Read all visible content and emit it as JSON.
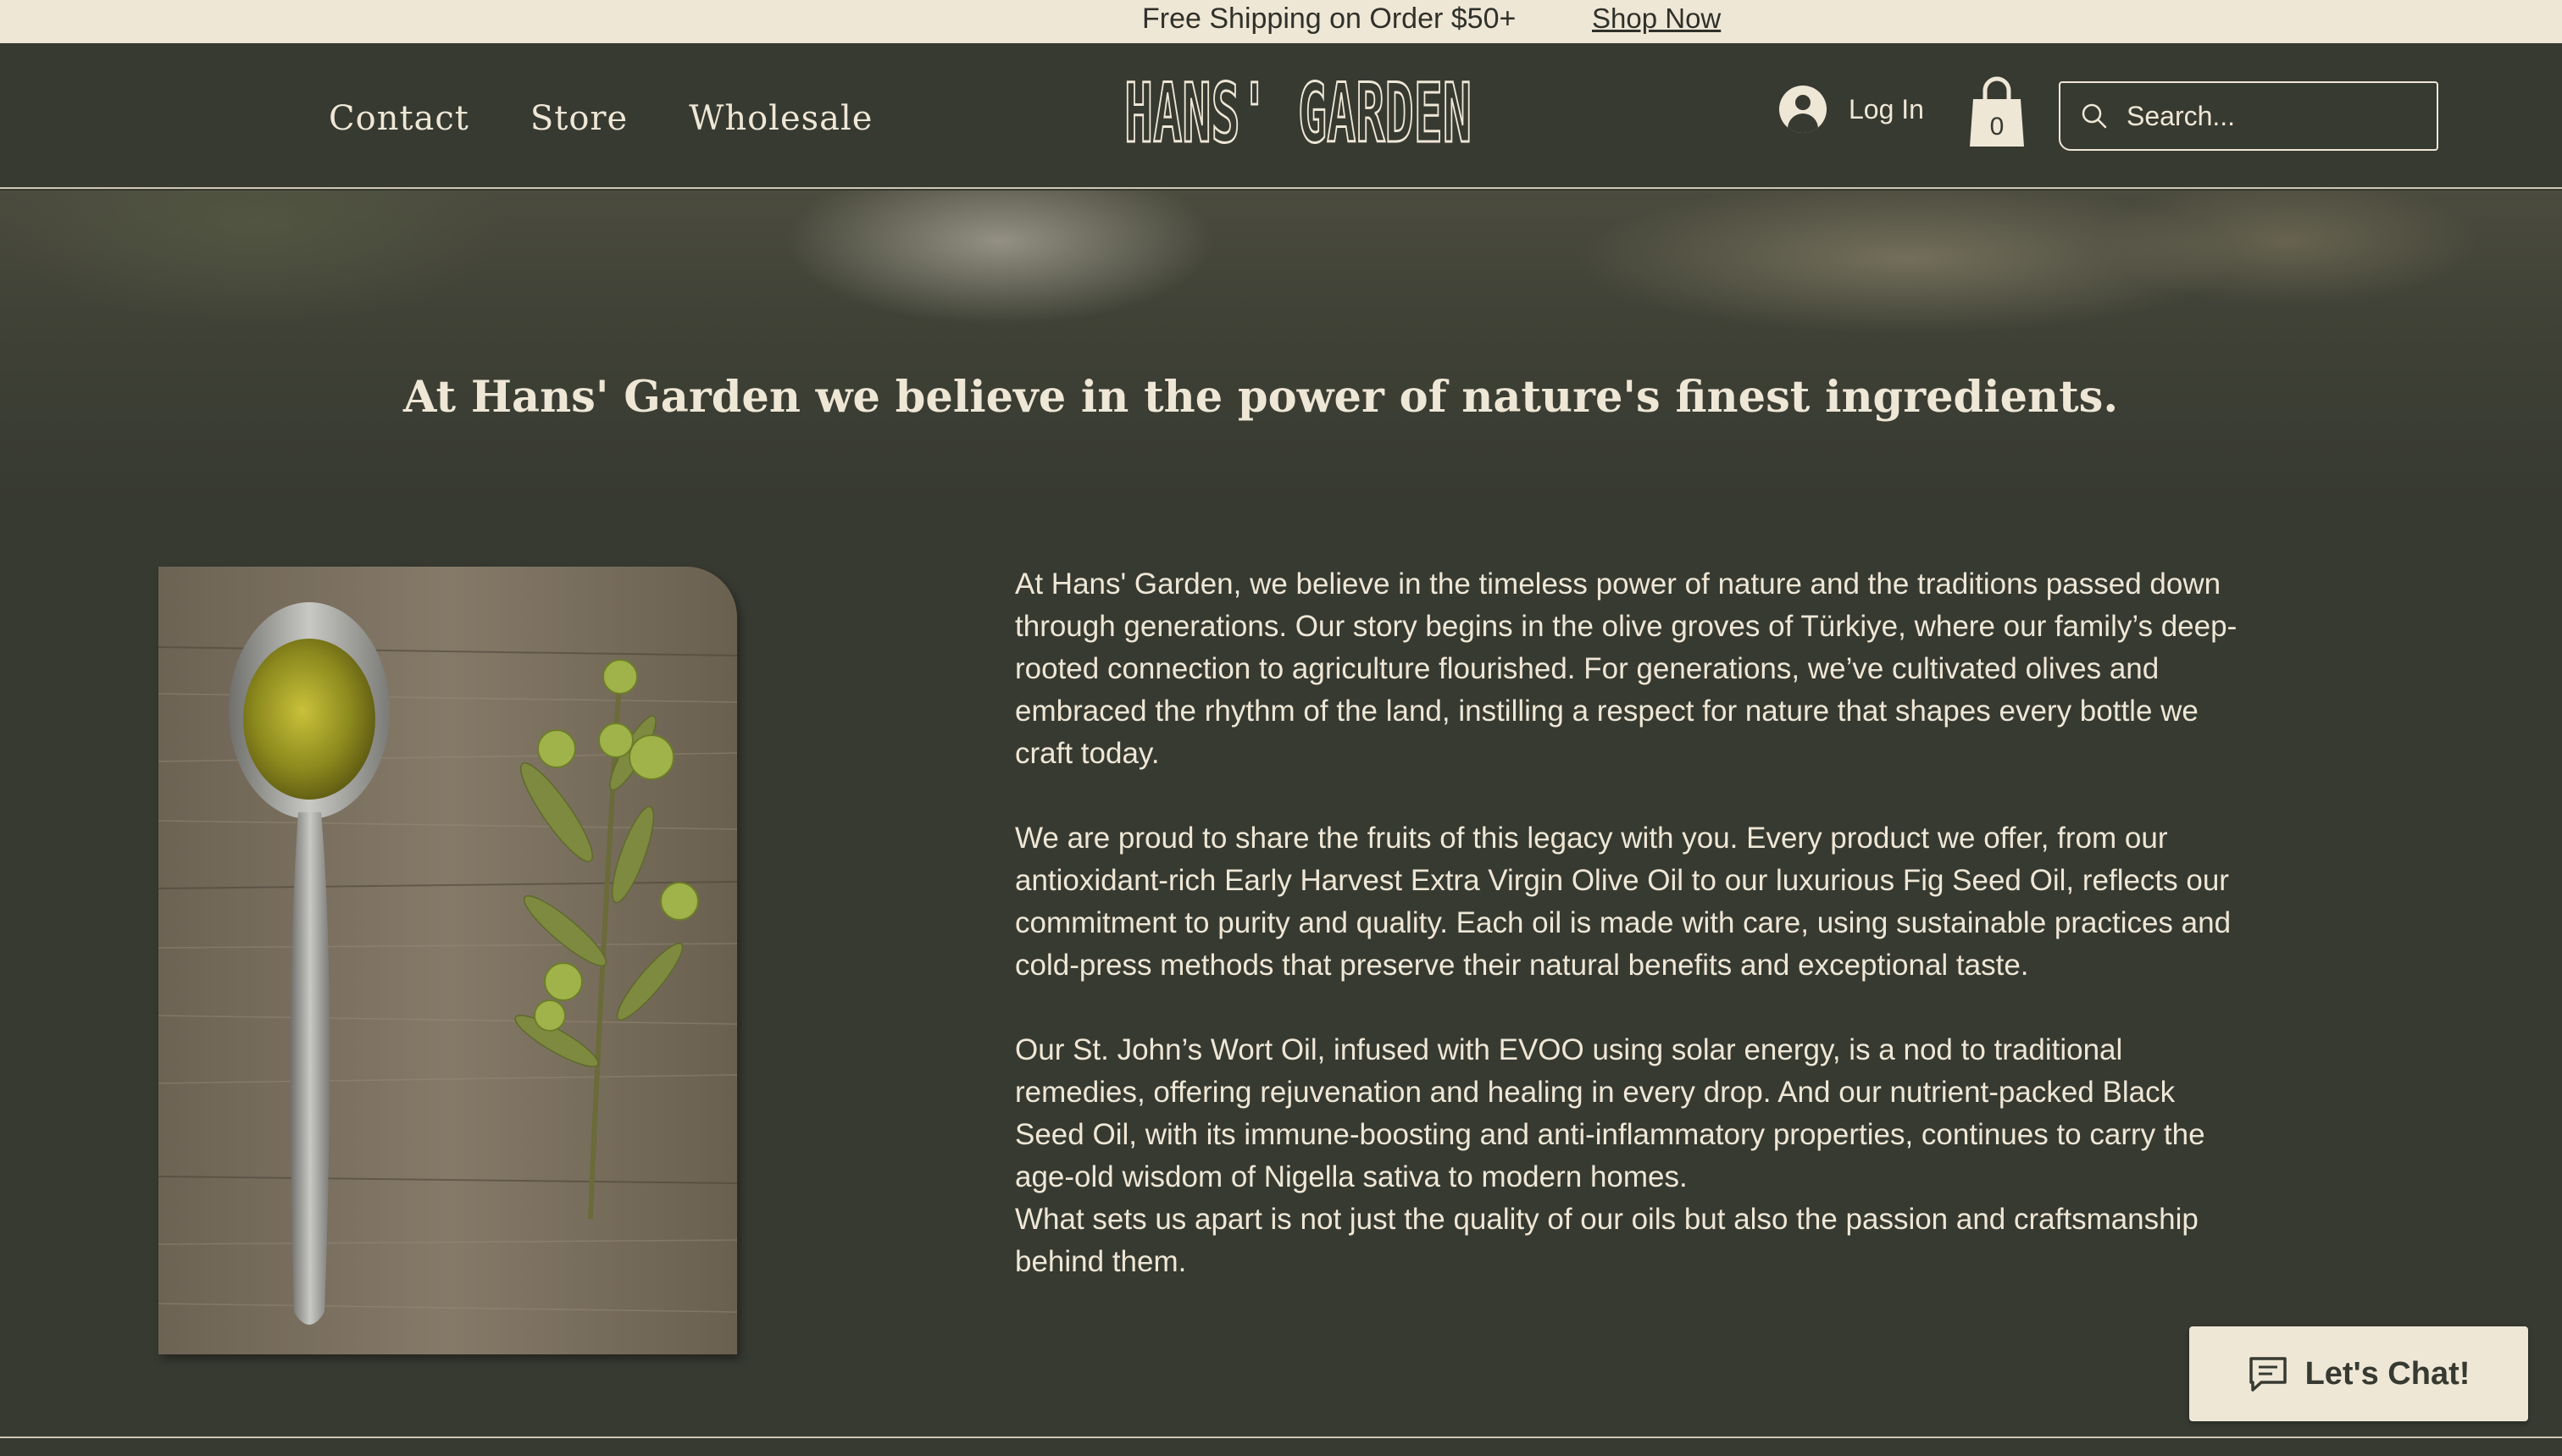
{
  "announcement": {
    "text": "Free Shipping on Order $50+",
    "link_label": "Shop Now"
  },
  "header": {
    "nav": [
      {
        "label": "Contact"
      },
      {
        "label": "Store"
      },
      {
        "label": "Wholesale"
      }
    ],
    "logo_text": "HANS' GARDEN",
    "login_label": "Log In",
    "cart_count": "0",
    "search_placeholder": "Search..."
  },
  "hero": {
    "title": "At Hans' Garden we believe in the power of nature's finest ingredients."
  },
  "story": {
    "paragraphs": [
      "At Hans' Garden, we believe in the timeless power of nature and the traditions passed down through generations. Our story begins in the olive groves of Türkiye, where our family’s deep-rooted connection to agriculture flourished. For generations, we’ve cultivated olives and embraced the rhythm of the land, instilling a respect for nature that shapes every bottle we craft today.",
      "We are proud to share the fruits of this legacy with you. Every product we offer, from our antioxidant-rich Early Harvest Extra Virgin Olive Oil to our luxurious Fig Seed Oil, reflects our commitment to purity and quality. Each oil is made with care, using sustainable practices and cold-press methods that preserve their natural benefits and exceptional taste.",
      "Our St. John’s Wort Oil, infused with EVOO using solar energy, is a nod to traditional remedies, offering rejuvenation and healing in every drop. And our nutrient-packed Black Seed Oil, with its immune-boosting and anti-inflammatory properties, continues to carry the age-old wisdom of Nigella sativa to modern homes.",
      "What sets us apart is not just the quality of our oils but also the passion and craftsmanship behind them."
    ]
  },
  "chat": {
    "label": "Let's Chat!"
  },
  "colors": {
    "background": "#373a31",
    "cream": "#efe7d6"
  },
  "icons": [
    "user-icon",
    "shopping-bag-icon",
    "search-icon",
    "chat-icon"
  ]
}
